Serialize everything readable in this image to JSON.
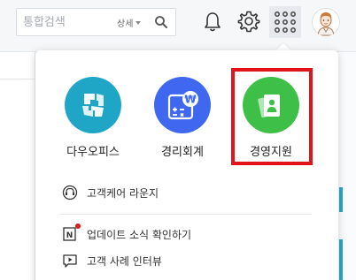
{
  "search": {
    "placeholder": "통합검색",
    "detail_label": "상세"
  },
  "header_icons": [
    "search-icon",
    "bell-icon",
    "gear-icon",
    "apps-grid-icon",
    "avatar"
  ],
  "app_launcher": {
    "apps": [
      {
        "label": "다우오피스",
        "icon": "dauoffice-icon",
        "color": "#1fa6c6"
      },
      {
        "label": "경리회계",
        "icon": "accounting-calculator-icon",
        "color": "#3f67f0"
      },
      {
        "label": "경영지원",
        "icon": "management-support-icon",
        "color": "#3dbf48"
      }
    ],
    "highlight_color": "#e1141c",
    "links": [
      {
        "label": "고객케어 라운지",
        "icon": "headset-icon"
      },
      {
        "label": "업데이트 소식 확인하기",
        "icon": "news-icon",
        "badge": true
      },
      {
        "label": "고객 사례 인터뷰",
        "icon": "video-chat-icon"
      }
    ]
  }
}
